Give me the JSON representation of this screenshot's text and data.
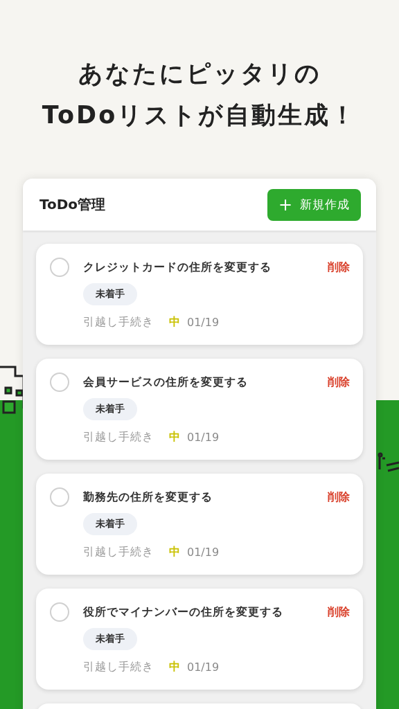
{
  "headline": [
    "あなたにピッタリの",
    "ToDoリストが自動生成！"
  ],
  "panel": {
    "title": "ToDo管理",
    "new_button": {
      "icon": "+",
      "label": "新規作成"
    }
  },
  "tasks": [
    {
      "title": "クレジットカードの住所を変更する",
      "done": false,
      "delete": "削除",
      "status": "未着手",
      "category": "引越し手続き",
      "priority": "中",
      "due": "01/19"
    },
    {
      "title": "会員サービスの住所を変更する",
      "done": false,
      "delete": "削除",
      "status": "未着手",
      "category": "引越し手続き",
      "priority": "中",
      "due": "01/19"
    },
    {
      "title": "勤務先の住所を変更する",
      "done": false,
      "delete": "削除",
      "status": "未着手",
      "category": "引越し手続き",
      "priority": "中",
      "due": "01/19"
    },
    {
      "title": "役所でマイナンバーの住所を変更する",
      "done": false,
      "delete": "削除",
      "status": "未着手",
      "category": "引越し手続き",
      "priority": "中",
      "due": "01/19"
    }
  ]
}
